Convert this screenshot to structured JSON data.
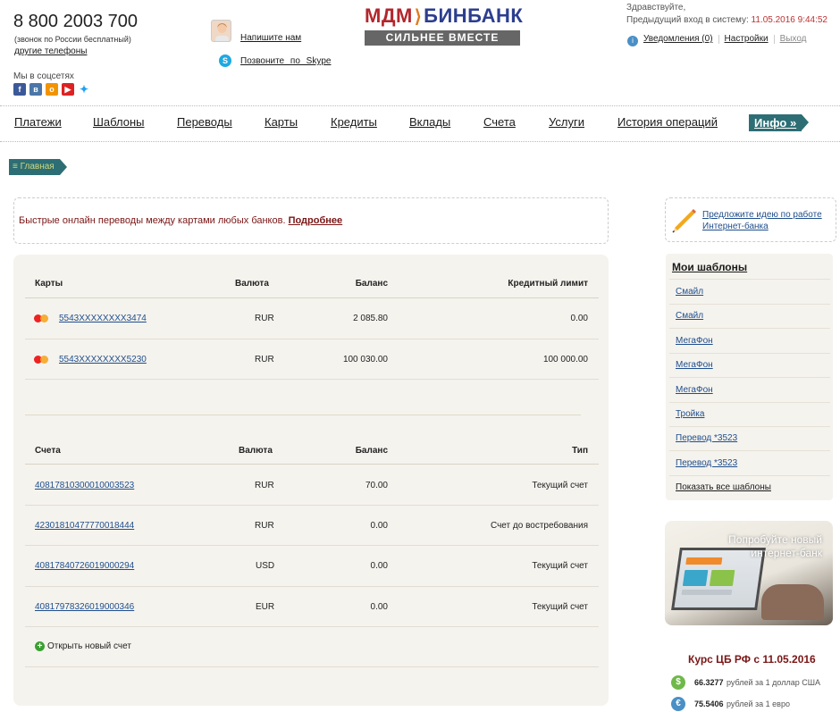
{
  "header": {
    "phone": "8 800 2003 700",
    "phone_note": "(звонок по России бесплатный)",
    "other_phones": "другие телефоны",
    "social_label": "Мы в соцсетях",
    "write_us": "Напишите нам",
    "skype_call": "Позвоните по Skype",
    "logo_mdm": "МДМ",
    "logo_bin": "БИНБАНК",
    "logo_slogan": "СИЛЬНЕЕ ВМЕСТЕ",
    "greeting": "Здравствуйте,",
    "last_login_label": "Предыдущий вход в систему:",
    "last_login_value": "11.05.2016 9:44:52",
    "notifications": "Уведомления (0)",
    "settings": "Настройки",
    "logout": "Выход"
  },
  "nav": {
    "items": [
      "Платежи",
      "Шаблоны",
      "Переводы",
      "Карты",
      "Кредиты",
      "Вклады",
      "Счета",
      "Услуги",
      "История операций"
    ],
    "info": "Инфо »"
  },
  "breadcrumb": "Главная",
  "promo": {
    "text": "Быстрые онлайн переводы между картами любых банков.",
    "more": "Подробнее"
  },
  "cards": {
    "headers": [
      "Карты",
      "Валюта",
      "Баланс",
      "Кредитный лимит"
    ],
    "rows": [
      {
        "number": "5543XXXXXXXX3474",
        "currency": "RUR",
        "balance": "2 085.80",
        "limit": "0.00"
      },
      {
        "number": "5543XXXXXXXX5230",
        "currency": "RUR",
        "balance": "100 030.00",
        "limit": "100 000.00"
      }
    ]
  },
  "accounts": {
    "headers": [
      "Счета",
      "Валюта",
      "Баланс",
      "Тип"
    ],
    "rows": [
      {
        "number": "40817810300010003523",
        "currency": "RUR",
        "balance": "70.00",
        "type": "Текущий счет"
      },
      {
        "number": "42301810477770018444",
        "currency": "RUR",
        "balance": "0.00",
        "type": "Счет до востребования"
      },
      {
        "number": "40817840726019000294",
        "currency": "USD",
        "balance": "0.00",
        "type": "Текущий счет"
      },
      {
        "number": "40817978326019000346",
        "currency": "EUR",
        "balance": "0.00",
        "type": "Текущий счет"
      }
    ],
    "open_new": "Открыть новый счет"
  },
  "sidebar": {
    "idea_line1": "Предложите идею по работе",
    "idea_line2": "Интернет-банка",
    "templates_title": "Мои шаблоны",
    "templates": [
      "Смайл",
      "Смайл",
      "МегаФон",
      "МегаФон",
      "МегаФон",
      "Тройка",
      "Перевод *3523",
      "Перевод *3523"
    ],
    "show_all": "Показать все шаблоны",
    "ad_text": "Попробуйте новый интернет-банк",
    "rates_title": "Курс ЦБ РФ с 11.05.2016",
    "rates": [
      {
        "symbol": "$",
        "value": "66.3277",
        "desc": "рублей за 1 доллар США",
        "color": "#6fb84a"
      },
      {
        "symbol": "€",
        "value": "75.5406",
        "desc": "рублей за 1 евро",
        "color": "#4a8fc6"
      }
    ]
  },
  "colors": {
    "accent": "#2d6e75",
    "link": "#1f4e8c",
    "promo_text": "#7a1515"
  }
}
